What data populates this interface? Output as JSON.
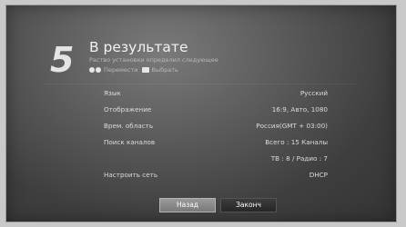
{
  "step": {
    "number": "5",
    "title": "В результате",
    "subtitle": "Раство установки определил следующее",
    "hints": [
      {
        "icon": "updown-arrows-icon",
        "label": "Перемести"
      },
      {
        "icon": "ok-button-icon",
        "label": "Выбрать"
      }
    ]
  },
  "settings": [
    {
      "label": "Язык",
      "value": "Русский"
    },
    {
      "label": "Отображение",
      "value": "16:9, Авто, 1080"
    },
    {
      "label": "Врем. область",
      "value": "Россия(GMT + 03:00)"
    },
    {
      "label": "Поиск каналов",
      "value": "Всего : 15 Каналы"
    },
    {
      "label": "",
      "value": "ТВ : 8 / Радио : 7"
    },
    {
      "label": "Настроить сеть",
      "value": "DHCP"
    }
  ],
  "buttons": {
    "back": "Назад",
    "finish": "Законч"
  }
}
